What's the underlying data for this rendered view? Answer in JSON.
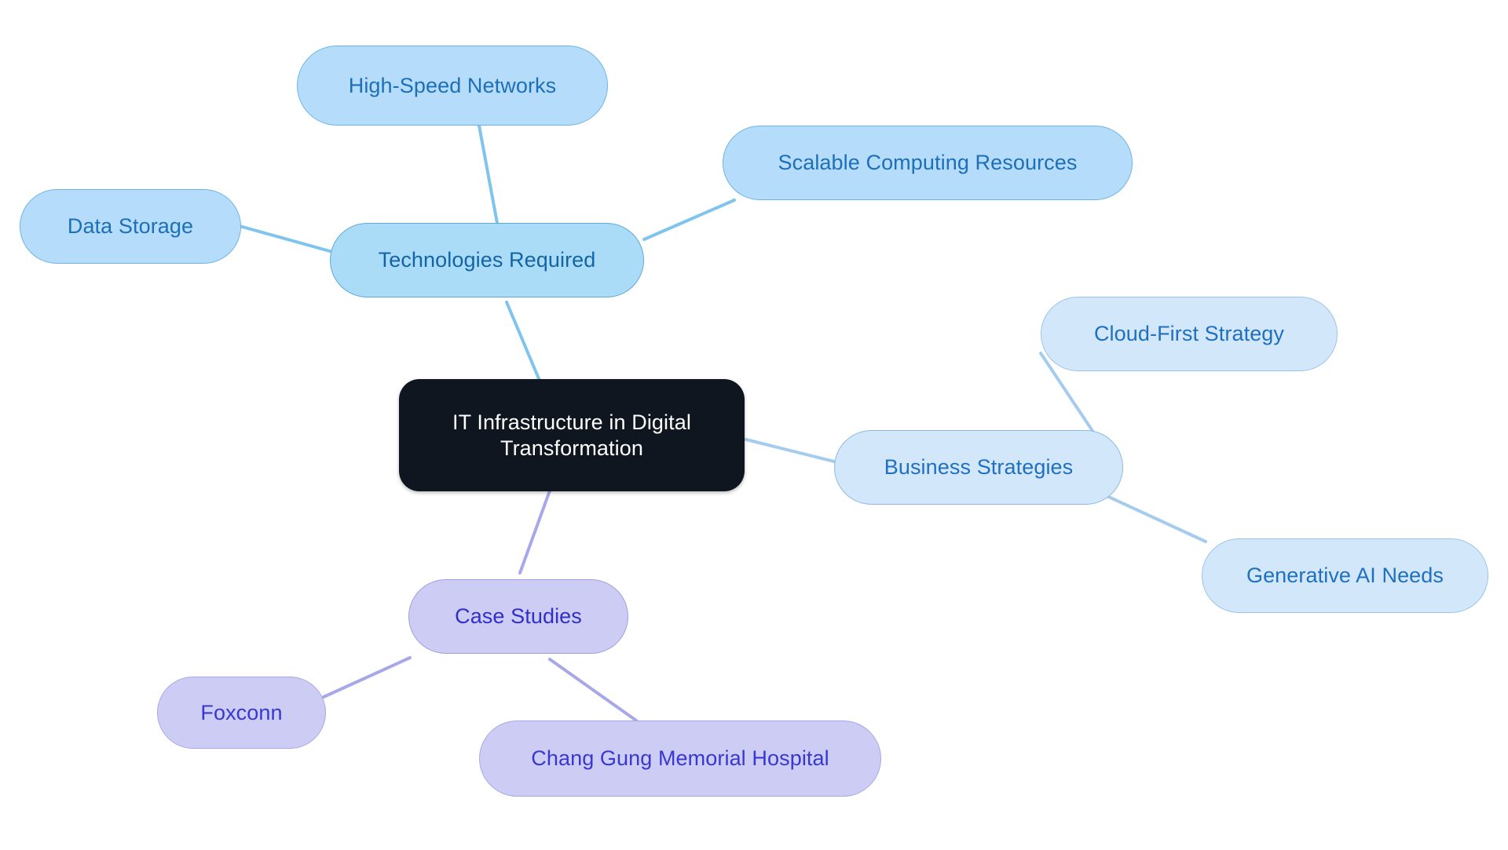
{
  "diagram": {
    "type": "mindmap",
    "title": "IT Infrastructure in Digital Transformation",
    "background_color": "#ffffff",
    "root": {
      "id": "root",
      "label": "IT Infrastructure in Digital\nTransformation",
      "fill": "#0f1620",
      "text_color": "#ffffff"
    },
    "branches": [
      {
        "id": "technologies-required",
        "label": "Technologies Required",
        "fill": "#aadcf7",
        "border": "#5fa8d8",
        "text_color": "#1464a5",
        "edge_color": "#7fc4ec",
        "children": [
          {
            "id": "high-speed-networks",
            "label": "High-Speed Networks",
            "fill": "#b5ddfb",
            "border": "#6fb4e0",
            "text_color": "#1d6fb8"
          },
          {
            "id": "data-storage",
            "label": "Data Storage",
            "fill": "#b5ddfb",
            "border": "#6fb4e0",
            "text_color": "#1d6fb8"
          },
          {
            "id": "scalable-computing-resources",
            "label": "Scalable Computing Resources",
            "fill": "#b5ddfb",
            "border": "#6fb4e0",
            "text_color": "#1d6fb8"
          }
        ]
      },
      {
        "id": "business-strategies",
        "label": "Business Strategies",
        "fill": "#d3e7fb",
        "border": "#8cb8e2",
        "text_color": "#2070c0",
        "edge_color": "#a6cced",
        "children": [
          {
            "id": "cloud-first-strategy",
            "label": "Cloud-First Strategy",
            "fill": "#d3e7fb",
            "border": "#9cc4e8",
            "text_color": "#2070c0"
          },
          {
            "id": "generative-ai-needs",
            "label": "Generative AI Needs",
            "fill": "#d3e7fb",
            "border": "#9cc4e8",
            "text_color": "#2070c0"
          }
        ]
      },
      {
        "id": "case-studies",
        "label": "Case Studies",
        "fill": "#ccccf5",
        "border": "#a0a0e0",
        "text_color": "#3030c8",
        "edge_color": "#a8a8e8",
        "children": [
          {
            "id": "foxconn",
            "label": "Foxconn",
            "fill": "#ccccf5",
            "border": "#a8a8e6",
            "text_color": "#3838d0"
          },
          {
            "id": "chang-gung-memorial-hospital",
            "label": "Chang Gung Memorial Hospital",
            "fill": "#ccccf5",
            "border": "#a8a8e6",
            "text_color": "#3838d0"
          }
        ]
      }
    ]
  },
  "nodes": {
    "root": "IT Infrastructure in Digital\nTransformation",
    "technologies_required": "Technologies Required",
    "high_speed_networks": "High-Speed Networks",
    "data_storage": "Data Storage",
    "scalable_computing_resources": "Scalable Computing Resources",
    "business_strategies": "Business Strategies",
    "cloud_first_strategy": "Cloud-First Strategy",
    "generative_ai_needs": "Generative AI Needs",
    "case_studies": "Case Studies",
    "foxconn": "Foxconn",
    "chang_gung_memorial_hospital": "Chang Gung Memorial Hospital"
  }
}
